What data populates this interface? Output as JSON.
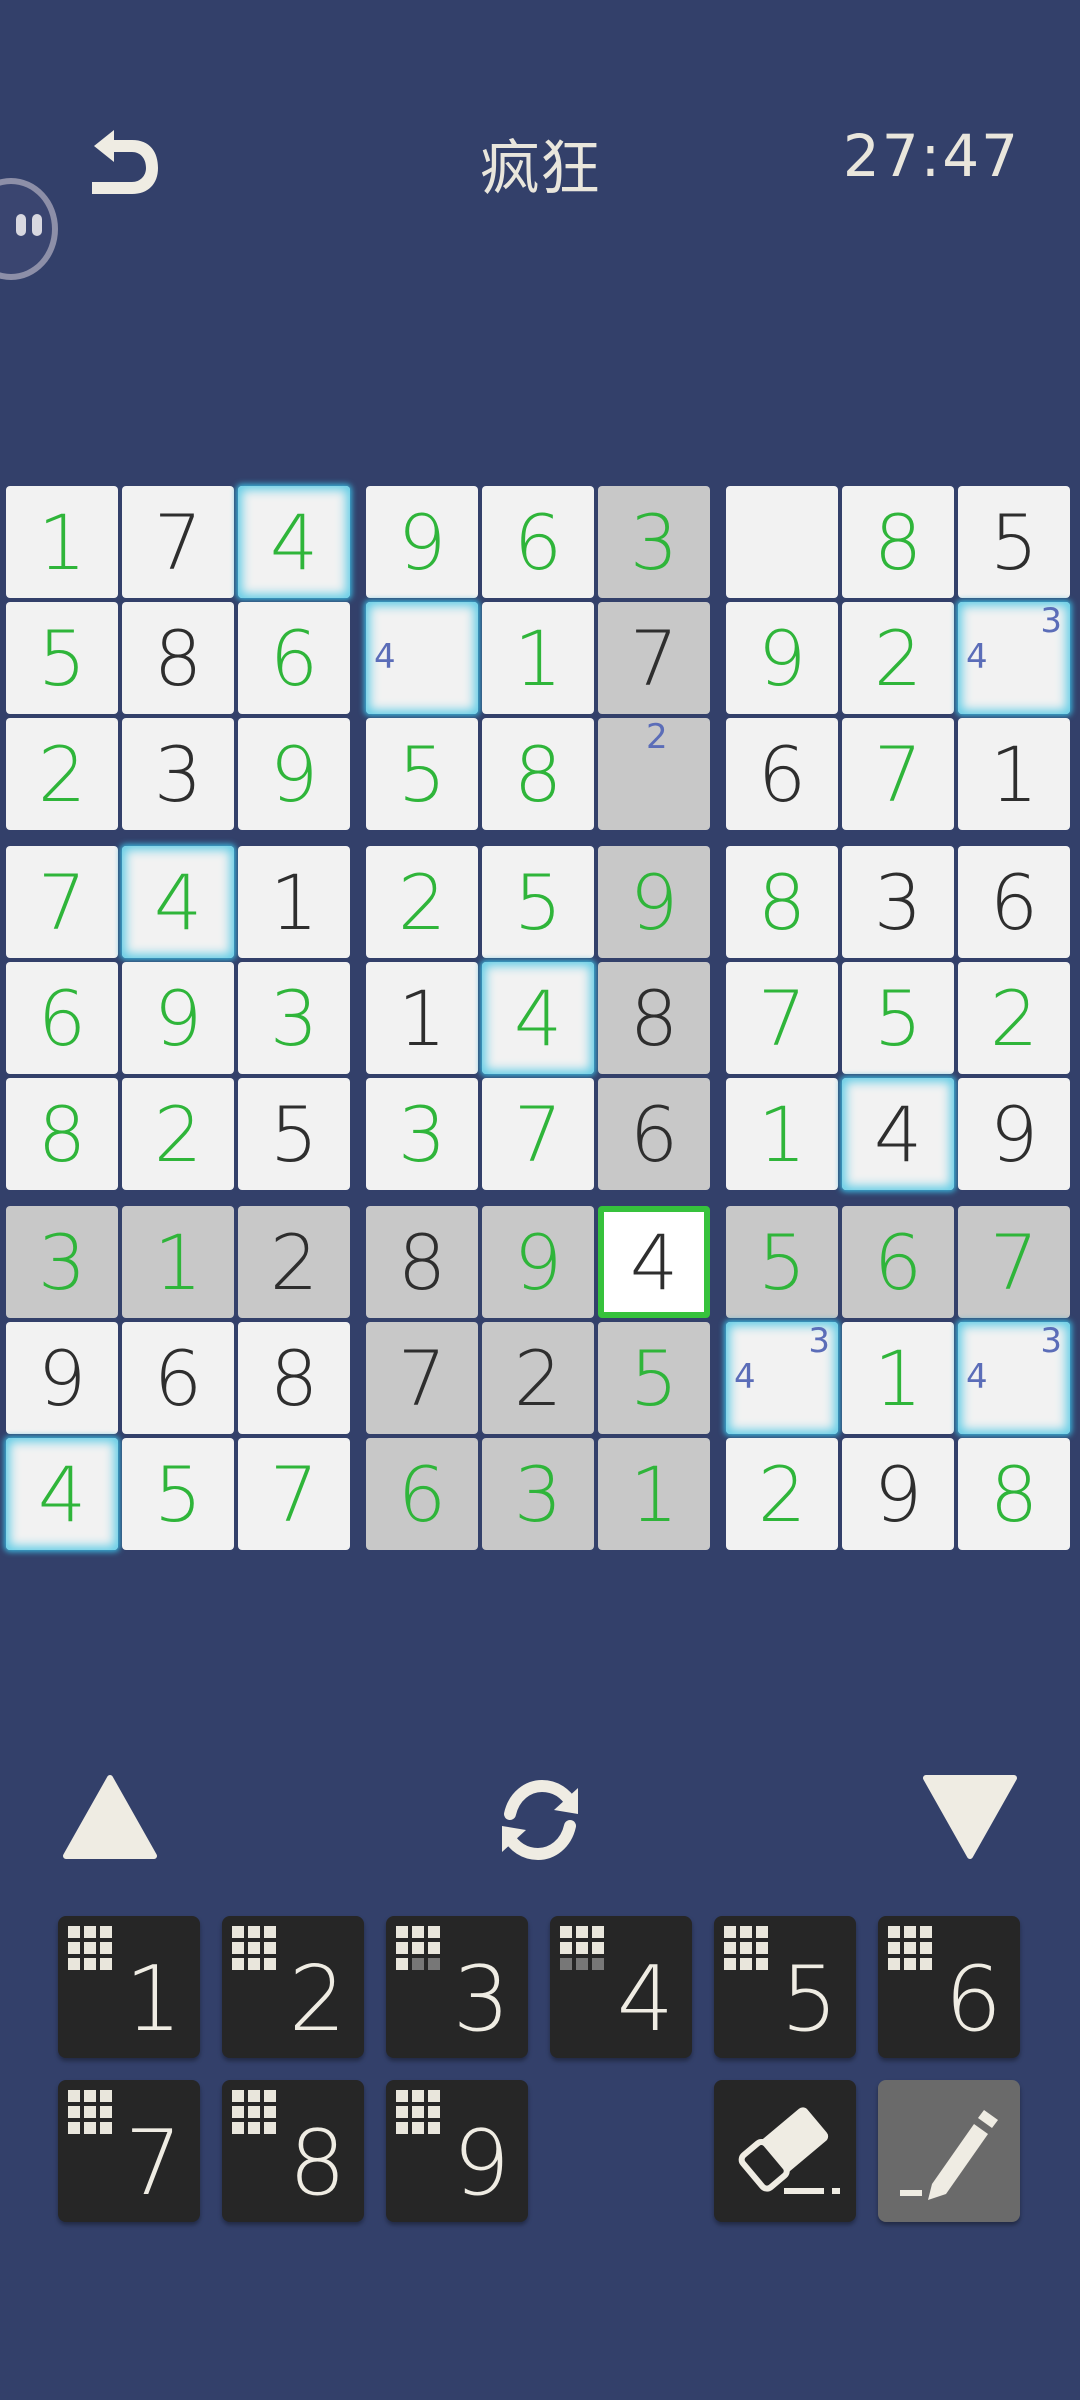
{
  "header": {
    "title": "疯狂",
    "timer": "27:47",
    "back_icon": "undo-arrow-icon"
  },
  "board": {
    "rows": [
      [
        "1",
        "7",
        "4",
        "9",
        "6",
        "3",
        "",
        "8",
        "5"
      ],
      [
        "5",
        "8",
        "6",
        "",
        "1",
        "7",
        "9",
        "2",
        ""
      ],
      [
        "2",
        "3",
        "9",
        "5",
        "8",
        "",
        "6",
        "7",
        "1"
      ],
      [
        "7",
        "4",
        "1",
        "2",
        "5",
        "9",
        "8",
        "3",
        "6"
      ],
      [
        "6",
        "9",
        "3",
        "1",
        "4",
        "8",
        "7",
        "5",
        "2"
      ],
      [
        "8",
        "2",
        "5",
        "3",
        "7",
        "6",
        "1",
        "4",
        "9"
      ],
      [
        "3",
        "1",
        "2",
        "8",
        "9",
        "4",
        "5",
        "6",
        "7"
      ],
      [
        "9",
        "6",
        "8",
        "7",
        "2",
        "5",
        "",
        "1",
        ""
      ],
      [
        "4",
        "5",
        "7",
        "6",
        "3",
        "1",
        "2",
        "9",
        "8"
      ]
    ],
    "given": [
      [
        0,
        1,
        0,
        0,
        0,
        0,
        0,
        0,
        1
      ],
      [
        0,
        1,
        0,
        0,
        0,
        1,
        0,
        0,
        0
      ],
      [
        0,
        1,
        0,
        0,
        0,
        0,
        1,
        0,
        1
      ],
      [
        0,
        0,
        1,
        0,
        0,
        0,
        0,
        1,
        1
      ],
      [
        0,
        0,
        0,
        1,
        0,
        1,
        0,
        0,
        0
      ],
      [
        0,
        0,
        1,
        0,
        0,
        1,
        0,
        1,
        1
      ],
      [
        0,
        0,
        1,
        1,
        0,
        1,
        0,
        0,
        0
      ],
      [
        1,
        1,
        1,
        1,
        1,
        0,
        0,
        0,
        0
      ],
      [
        0,
        0,
        0,
        0,
        0,
        0,
        0,
        1,
        0
      ]
    ],
    "highlighted": [
      [
        0,
        0,
        0,
        0,
        0,
        1,
        0,
        0,
        0
      ],
      [
        0,
        0,
        0,
        0,
        0,
        1,
        0,
        0,
        0
      ],
      [
        0,
        0,
        0,
        0,
        0,
        1,
        0,
        0,
        0
      ],
      [
        0,
        0,
        0,
        0,
        0,
        1,
        0,
        0,
        0
      ],
      [
        0,
        0,
        0,
        0,
        0,
        1,
        0,
        0,
        0
      ],
      [
        0,
        0,
        0,
        0,
        0,
        1,
        0,
        0,
        0
      ],
      [
        1,
        1,
        1,
        1,
        1,
        0,
        1,
        1,
        1
      ],
      [
        0,
        0,
        0,
        1,
        1,
        1,
        0,
        0,
        0
      ],
      [
        0,
        0,
        0,
        1,
        1,
        1,
        0,
        0,
        0
      ]
    ],
    "conflict": [
      [
        0,
        0,
        1,
        0,
        0,
        0,
        0,
        0,
        0
      ],
      [
        0,
        0,
        0,
        1,
        0,
        0,
        0,
        0,
        1
      ],
      [
        0,
        0,
        0,
        0,
        0,
        0,
        0,
        0,
        0
      ],
      [
        0,
        1,
        0,
        0,
        0,
        0,
        0,
        0,
        0
      ],
      [
        0,
        0,
        0,
        0,
        1,
        0,
        0,
        0,
        0
      ],
      [
        0,
        0,
        0,
        0,
        0,
        0,
        0,
        1,
        0
      ],
      [
        0,
        0,
        0,
        0,
        0,
        0,
        0,
        0,
        0
      ],
      [
        0,
        0,
        0,
        0,
        0,
        0,
        1,
        0,
        1
      ],
      [
        1,
        0,
        0,
        0,
        0,
        0,
        0,
        0,
        0
      ]
    ],
    "selected": [
      6,
      5
    ],
    "notes": [
      {
        "row": 1,
        "col": 3,
        "marks": [
          {
            "v": "4",
            "pos": "mid-left"
          }
        ]
      },
      {
        "row": 1,
        "col": 8,
        "marks": [
          {
            "v": "4",
            "pos": "mid-left"
          },
          {
            "v": "3",
            "pos": "top-right"
          }
        ]
      },
      {
        "row": 2,
        "col": 5,
        "marks": [
          {
            "v": "2",
            "pos": "top-center"
          }
        ]
      },
      {
        "row": 7,
        "col": 6,
        "marks": [
          {
            "v": "4",
            "pos": "mid-left"
          },
          {
            "v": "3",
            "pos": "top-right"
          }
        ]
      },
      {
        "row": 7,
        "col": 8,
        "marks": [
          {
            "v": "4",
            "pos": "mid-left"
          },
          {
            "v": "3",
            "pos": "top-right"
          }
        ]
      }
    ],
    "colors": {
      "given": "#2e2e2e",
      "user": "#2fb53a",
      "note": "#5b6db8",
      "highlight": "#c8c8c8",
      "cell": "#f2f2f2",
      "select_border": "#36c23c",
      "conflict_glow": "#64cde6"
    }
  },
  "controls": {
    "up_icon": "triangle-up-icon",
    "down_icon": "triangle-down-icon",
    "refresh_icon": "refresh-icon"
  },
  "numpad": {
    "keys": [
      {
        "digit": "1",
        "filled": 9
      },
      {
        "digit": "2",
        "filled": 9
      },
      {
        "digit": "3",
        "filled": 7
      },
      {
        "digit": "4",
        "filled": 6
      },
      {
        "digit": "5",
        "filled": 9
      },
      {
        "digit": "6",
        "filled": 9
      },
      {
        "digit": "7",
        "filled": 9
      },
      {
        "digit": "8",
        "filled": 9
      },
      {
        "digit": "9",
        "filled": 9
      }
    ],
    "eraser_icon": "eraser-icon",
    "pencil_icon": "pencil-icon"
  }
}
